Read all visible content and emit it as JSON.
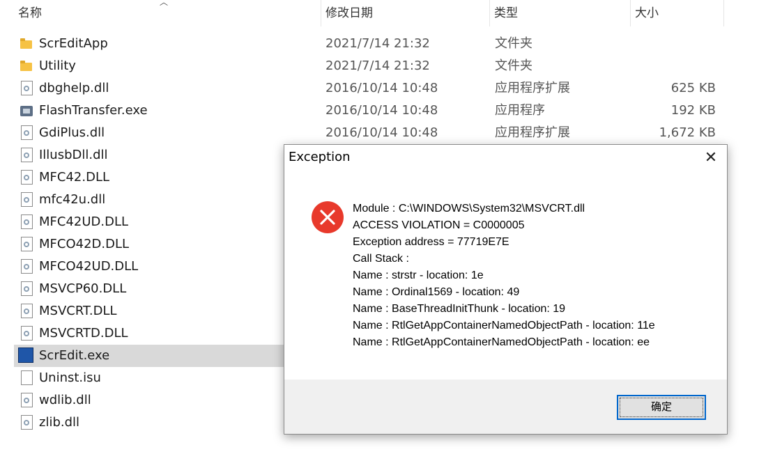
{
  "columns": {
    "name": "名称",
    "date": "修改日期",
    "type": "类型",
    "size": "大小"
  },
  "files": [
    {
      "name": "ScrEditApp",
      "date": "2021/7/14 21:32",
      "type": "文件夹",
      "size": "",
      "icon": "folder-icon"
    },
    {
      "name": "Utility",
      "date": "2021/7/14 21:32",
      "type": "文件夹",
      "size": "",
      "icon": "folder-icon"
    },
    {
      "name": "dbghelp.dll",
      "date": "2016/10/14 10:48",
      "type": "应用程序扩展",
      "size": "625 KB",
      "icon": "dll-file-icon"
    },
    {
      "name": "FlashTransfer.exe",
      "date": "2016/10/14 10:48",
      "type": "应用程序",
      "size": "192 KB",
      "icon": "exe-file-icon"
    },
    {
      "name": "GdiPlus.dll",
      "date": "2016/10/14 10:48",
      "type": "应用程序扩展",
      "size": "1,672 KB",
      "icon": "dll-file-icon"
    },
    {
      "name": "IllusbDll.dll",
      "date": "",
      "type": "",
      "size": "",
      "icon": "dll-file-icon"
    },
    {
      "name": "MFC42.DLL",
      "date": "",
      "type": "",
      "size": "",
      "icon": "dll-file-icon"
    },
    {
      "name": "mfc42u.dll",
      "date": "",
      "type": "",
      "size": "",
      "icon": "dll-file-icon"
    },
    {
      "name": "MFC42UD.DLL",
      "date": "",
      "type": "",
      "size": "",
      "icon": "dll-file-icon"
    },
    {
      "name": "MFCO42D.DLL",
      "date": "",
      "type": "",
      "size": "",
      "icon": "dll-file-icon"
    },
    {
      "name": "MFCO42UD.DLL",
      "date": "",
      "type": "",
      "size": "",
      "icon": "dll-file-icon"
    },
    {
      "name": "MSVCP60.DLL",
      "date": "",
      "type": "",
      "size": "",
      "icon": "dll-file-icon"
    },
    {
      "name": "MSVCRT.DLL",
      "date": "",
      "type": "",
      "size": "",
      "icon": "dll-file-icon"
    },
    {
      "name": "MSVCRTD.DLL",
      "date": "",
      "type": "",
      "size": "",
      "icon": "dll-file-icon"
    },
    {
      "name": "ScrEdit.exe",
      "date": "",
      "type": "",
      "size": "",
      "icon": "screedit-app-icon",
      "selected": true
    },
    {
      "name": "Uninst.isu",
      "date": "",
      "type": "",
      "size": "",
      "icon": "blank-file-icon"
    },
    {
      "name": "wdlib.dll",
      "date": "",
      "type": "",
      "size": "",
      "icon": "dll-file-icon"
    },
    {
      "name": "zlib.dll",
      "date": "",
      "type": "",
      "size": "",
      "icon": "dll-file-icon"
    }
  ],
  "dialog": {
    "title": "Exception",
    "close_icon": "close-icon",
    "error_icon": "error-icon",
    "error_color": "#e8392b",
    "lines": [
      "Module : C:\\WINDOWS\\System32\\MSVCRT.dll",
      "ACCESS VIOLATION = C0000005",
      "Exception address = 77719E7E",
      "Call Stack :",
      "Name : strstr - location: 1e",
      "Name : Ordinal1569 - location: 49",
      "Name : BaseThreadInitThunk - location: 19",
      "Name : RtlGetAppContainerNamedObjectPath - location: 11e",
      "Name : RtlGetAppContainerNamedObjectPath - location: ee"
    ],
    "ok_label": "确定"
  }
}
